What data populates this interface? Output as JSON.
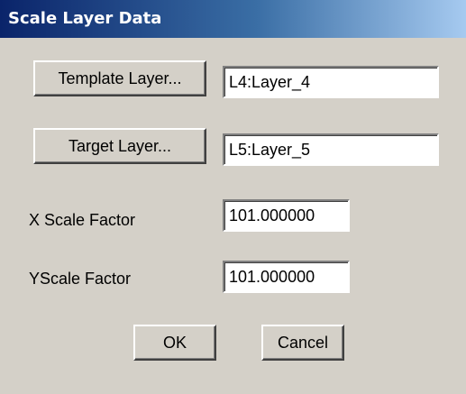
{
  "window": {
    "title": "Scale Layer Data"
  },
  "template_layer": {
    "button_label": "Template Layer...",
    "value": "L4:Layer_4"
  },
  "target_layer": {
    "button_label": "Target Layer...",
    "value": "L5:Layer_5"
  },
  "x_scale": {
    "label": "X Scale Factor",
    "value": "101.000000"
  },
  "y_scale": {
    "label": "YScale Factor",
    "value": "101.000000"
  },
  "actions": {
    "ok_label": "OK",
    "cancel_label": "Cancel"
  },
  "colors": {
    "title_gradient_start": "#0a246a",
    "title_gradient_end": "#a6caf0",
    "dialog_face": "#d4d0c8"
  }
}
